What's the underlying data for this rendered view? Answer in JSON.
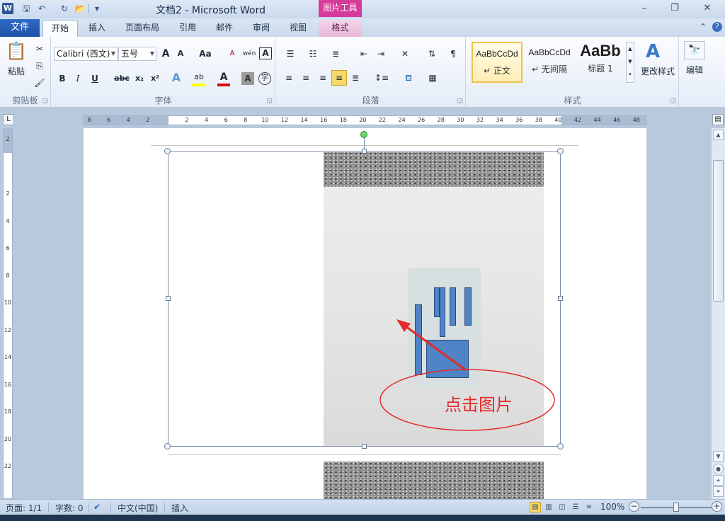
{
  "window": {
    "app_icon": "W",
    "title": "文档2 - Microsoft Word",
    "context_group": "图片工具",
    "controls": {
      "minimize": "–",
      "restore": "❐",
      "close": "✕"
    }
  },
  "quick_access": {
    "save": "🖫",
    "undo": "↶",
    "redo": "↻",
    "open": "📂",
    "customize": "▾"
  },
  "tabs": {
    "file": "文件",
    "items": [
      "开始",
      "插入",
      "页面布局",
      "引用",
      "邮件",
      "审阅",
      "视图"
    ],
    "context_tab": "格式",
    "collapse": "⌃",
    "help": "?"
  },
  "ribbon": {
    "clipboard": {
      "label": "剪贴板",
      "paste": "粘贴",
      "cut_icon": "✂",
      "copy_icon": "⎘",
      "format_painter_icon": "🖌",
      "paste_icon": "📋"
    },
    "font": {
      "label": "字体",
      "font_name": "Calibri (西文)",
      "font_size": "五号",
      "grow": "A",
      "shrink": "A",
      "change_case": "Aa",
      "clear_format": "A",
      "phonetic": "wén",
      "border": "A",
      "bold": "B",
      "italic": "I",
      "underline": "U",
      "strike": "abc",
      "subscript": "x₂",
      "superscript": "x²",
      "effects": "A",
      "highlight": "ab",
      "font_color": "A",
      "shading": "A",
      "enclose": "字"
    },
    "paragraph": {
      "label": "段落"
    },
    "styles": {
      "label": "样式",
      "items": [
        {
          "sample": "AaBbCcDd",
          "name": "↵ 正文"
        },
        {
          "sample": "AaBbCcDd",
          "name": "↵ 无间隔"
        },
        {
          "sample": "AaBb",
          "name": "标题 1"
        }
      ],
      "change_styles": "更改样式",
      "change_styles_icon": "A"
    },
    "editing": {
      "label": "编辑",
      "icon": "🔭"
    }
  },
  "ruler": {
    "h_ticks": [
      "8",
      "6",
      "4",
      "2",
      "",
      "2",
      "4",
      "6",
      "8",
      "10",
      "12",
      "14",
      "16",
      "18",
      "20",
      "22",
      "24",
      "26",
      "28",
      "30",
      "32",
      "34",
      "36",
      "38",
      "40",
      "42",
      "44",
      "46",
      "48"
    ],
    "v_ticks": [
      "2",
      "",
      "2",
      "4",
      "6",
      "8",
      "10",
      "12",
      "14",
      "16",
      "18",
      "20",
      "22"
    ],
    "corner": "L"
  },
  "annotation": {
    "text": "点击图片"
  },
  "status": {
    "page": "页面: 1/1",
    "words": "字数: 0",
    "language": "中文(中国)",
    "mode": "插入",
    "zoom": "100%",
    "zoom_minus": "−",
    "zoom_plus": "+",
    "zoom_level": 1.0
  },
  "colors": {
    "accent": "#2b579a",
    "picture_tools": "#d63a9b",
    "annotation": "#e32a2a",
    "card_blocks": "#4f84c6"
  }
}
